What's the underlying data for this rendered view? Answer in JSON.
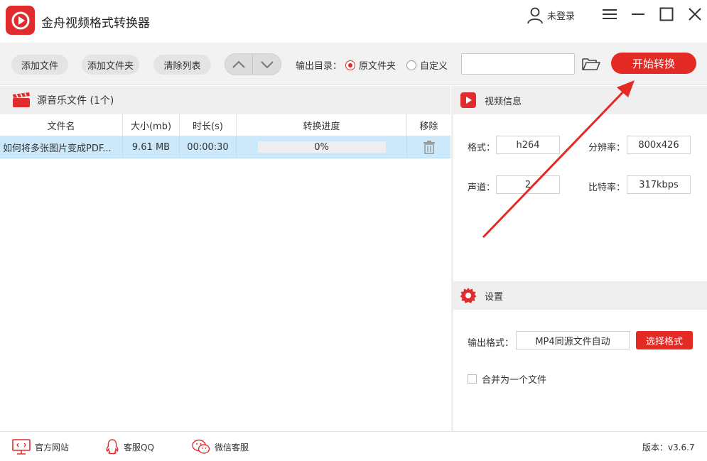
{
  "app": {
    "title": "金舟视频格式转换器"
  },
  "user": {
    "login_label": "未登录"
  },
  "toolbar": {
    "add_file": "添加文件",
    "add_folder": "添加文件夹",
    "clear_list": "清除列表",
    "output_dir_label": "输出目录：",
    "radio_original": "原文件夹",
    "radio_custom": "自定义",
    "path_value": "",
    "start_button": "开始转换"
  },
  "file_list": {
    "section_title": "源音乐文件 (1个)",
    "columns": [
      "文件名",
      "大小(mb)",
      "时长(s)",
      "转换进度",
      "移除"
    ],
    "rows": [
      {
        "name": "如何将多张图片变成PDF...",
        "size": "9.61 MB",
        "duration": "00:00:30",
        "progress": "0%"
      }
    ]
  },
  "video_info": {
    "section_title": "视频信息",
    "format_label": "格式：",
    "format_value": "h264",
    "resolution_label": "分辨率：",
    "resolution_value": "800x426",
    "channel_label": "声道：",
    "channel_value": "2",
    "bitrate_label": "比特率：",
    "bitrate_value": "317kbps"
  },
  "settings": {
    "section_title": "设置",
    "output_format_label": "输出格式：",
    "output_format_value": "MP4同源文件自动",
    "choose_format_button": "选择格式",
    "merge_label": "合并为一个文件"
  },
  "footer": {
    "website": "官方网站",
    "qq": "客服QQ",
    "wechat": "微信客服",
    "version": "版本：v3.6.7"
  },
  "colors": {
    "accent": "#e32a24",
    "selected_row": "#cce8fb",
    "panel_header": "#efefef"
  }
}
